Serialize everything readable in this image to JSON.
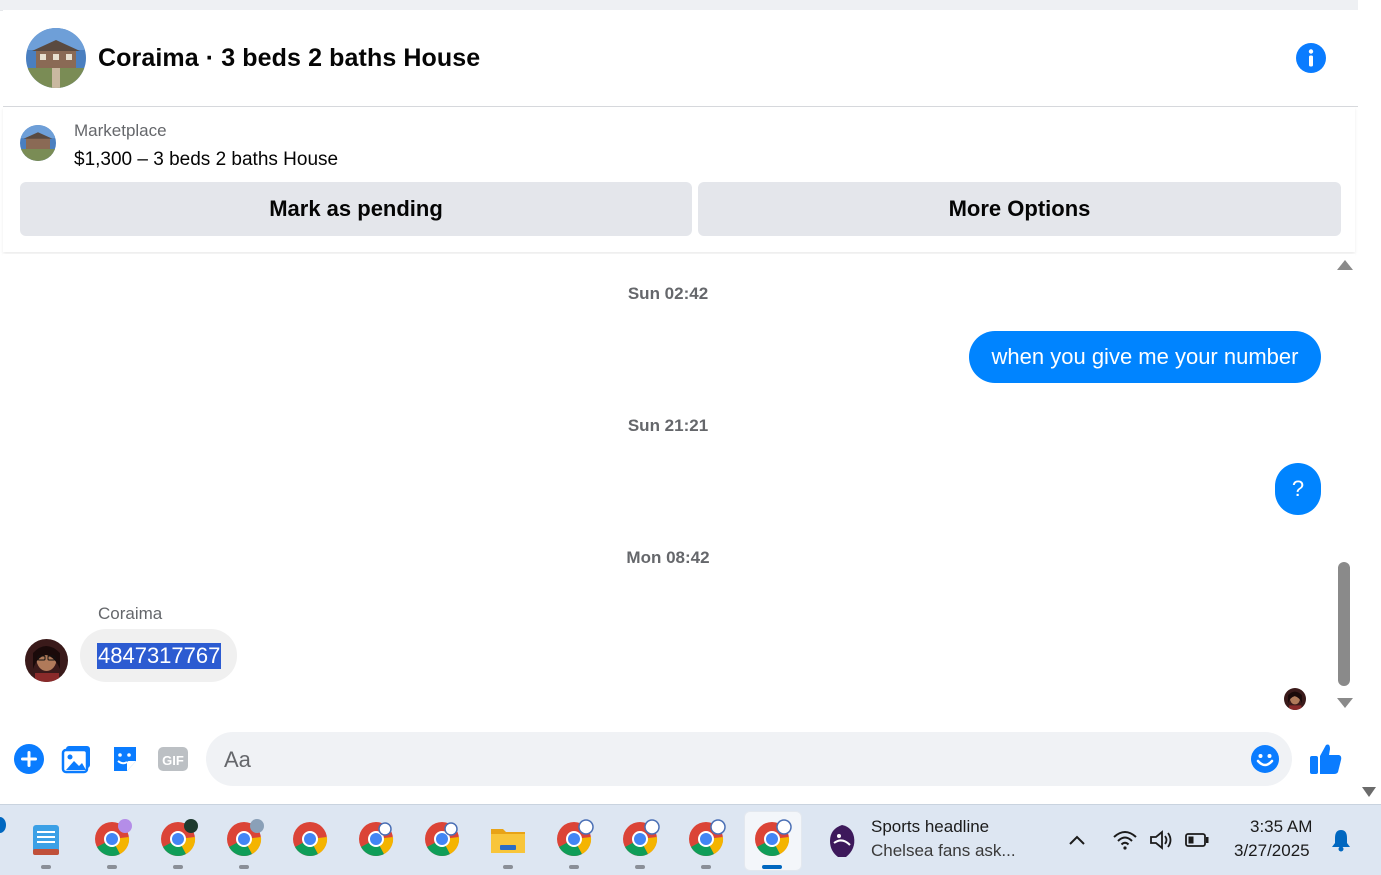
{
  "conversation": {
    "title": "Coraima · 3 beds 2 baths House",
    "info_icon": "info-icon"
  },
  "listing": {
    "label": "Marketplace",
    "title": "$1,300 – 3 beds 2 baths House",
    "mark_pending_label": "Mark as pending",
    "more_options_label": "More Options"
  },
  "messages": [
    {
      "type": "timestamp",
      "text": "Sun 02:42"
    },
    {
      "type": "outgoing",
      "text": "when you give me your number"
    },
    {
      "type": "timestamp",
      "text": "Sun 21:21"
    },
    {
      "type": "outgoing",
      "text": "?"
    },
    {
      "type": "timestamp",
      "text": "Mon 08:42"
    },
    {
      "type": "incoming",
      "sender": "Coraima",
      "text": "4847317767"
    }
  ],
  "composer": {
    "placeholder": "Aa",
    "icons": [
      "plus-icon",
      "photo-icon",
      "sticker-icon",
      "gif-icon",
      "emoji-icon",
      "thumbs-up-icon"
    ],
    "gif_label": "GIF"
  },
  "taskbar": {
    "news_title": "Sports headline",
    "news_subtitle": "Chelsea fans ask...",
    "time": "3:35 AM",
    "date": "3/27/2025"
  },
  "colors": {
    "messenger_blue": "#0084ff",
    "button_gray": "#e4e6eb",
    "text_secondary": "#65676b",
    "selection": "#2c5bd1"
  }
}
